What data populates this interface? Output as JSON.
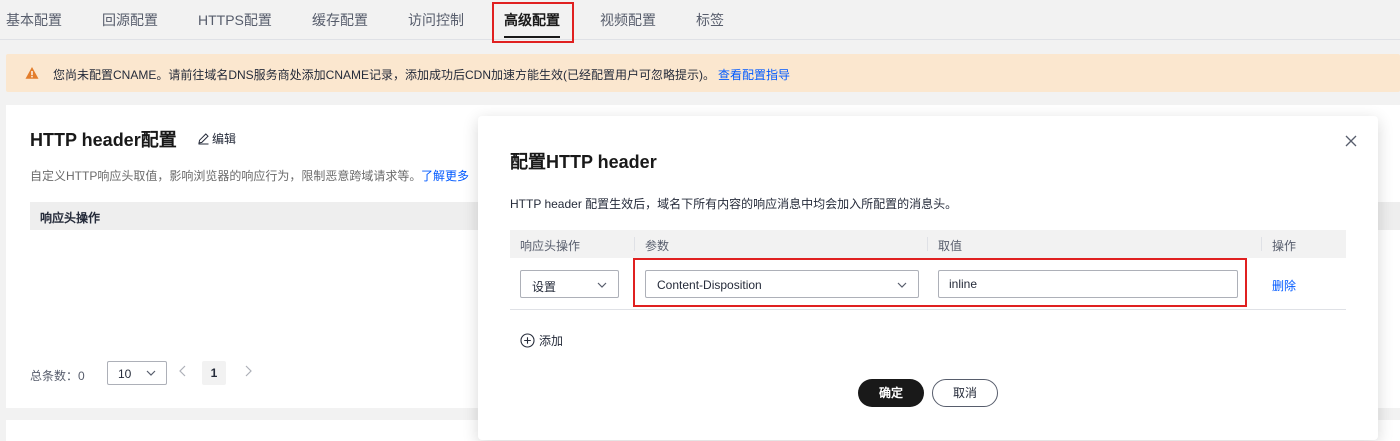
{
  "tabs": [
    {
      "label": "基本配置"
    },
    {
      "label": "回源配置"
    },
    {
      "label": "HTTPS配置"
    },
    {
      "label": "缓存配置"
    },
    {
      "label": "访问控制"
    },
    {
      "label": "高级配置"
    },
    {
      "label": "视频配置"
    },
    {
      "label": "标签"
    }
  ],
  "active_tab": "高级配置",
  "notice": {
    "text": "您尚未配置CNAME。请前往域名DNS服务商处添加CNAME记录，添加成功后CDN加速方能生效(已经配置用户可忽略提示)。",
    "link": "查看配置指导",
    "icon": "warning-icon"
  },
  "card": {
    "title": "HTTP header配置",
    "edit_label": "编辑",
    "description": "自定义HTTP响应头取值，影响浏览器的响应行为，限制恶意跨域请求等。",
    "learn_more": "了解更多",
    "table_header": "响应头操作",
    "pager": {
      "total_label": "总条数：0",
      "page_size": "10",
      "current_page": "1"
    }
  },
  "modal": {
    "title": "配置HTTP header",
    "description": "HTTP header 配置生效后，域名下所有内容的响应消息中均会加入所配置的消息头。",
    "columns": [
      "响应头操作",
      "参数",
      "取值",
      "操作"
    ],
    "row": {
      "operation": "设置",
      "parameter": "Content-Disposition",
      "value": "inline",
      "delete_label": "删除"
    },
    "add_label": "添加",
    "ok_label": "确定",
    "cancel_label": "取消"
  },
  "colors": {
    "highlight": "#e02020",
    "link": "#0059ff",
    "notice_bg": "#fbe7cf",
    "warning": "#e37d2b"
  }
}
